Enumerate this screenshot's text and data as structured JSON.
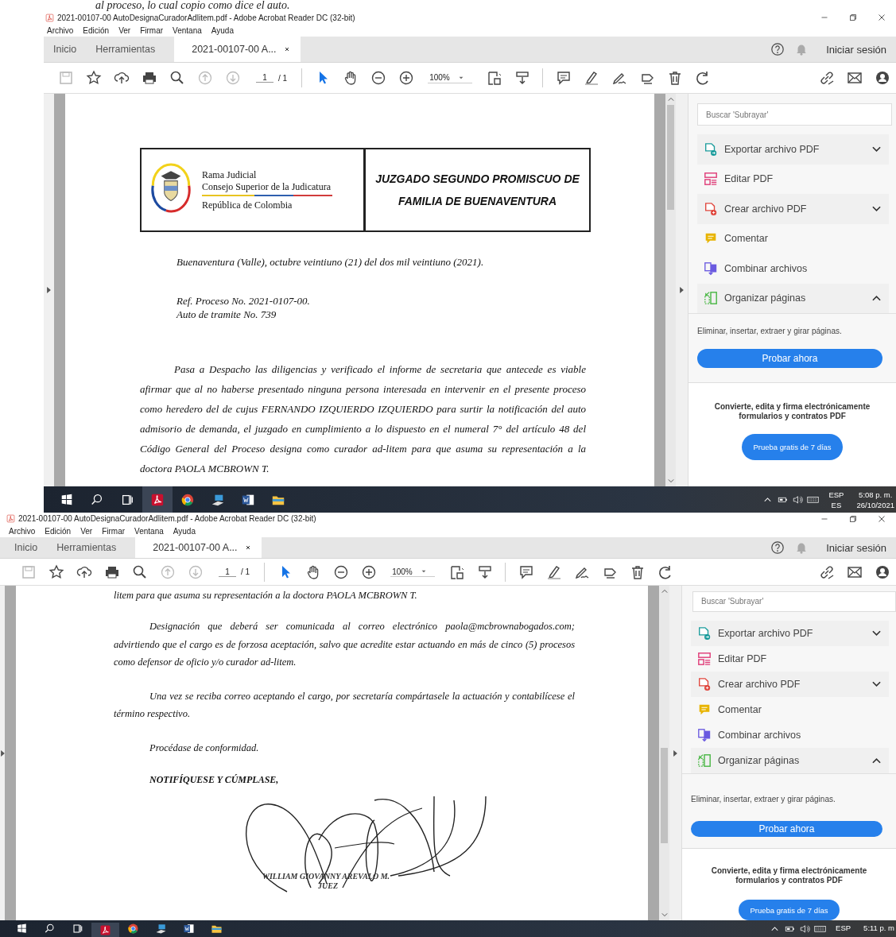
{
  "caption": "al proceso, lo cual copio como dice el auto.",
  "screens": [
    {
      "title": "2021-00107-00 AutoDesignaCuradorAdlitem.pdf - Adobe Acrobat Reader DC (32-bit)",
      "menu": [
        "Archivo",
        "Edición",
        "Ver",
        "Firmar",
        "Ventana",
        "Ayuda"
      ],
      "tabs": [
        {
          "label": "Inicio",
          "selected": false
        },
        {
          "label": "Herramientas",
          "selected": false
        },
        {
          "label": "2021-00107-00 A...",
          "selected": true
        }
      ],
      "sign_in": "Iniciar sesión",
      "page_number": "1",
      "page_total": "/ 1",
      "zoom": "100%",
      "search_placeholder": "Buscar 'Subrayar'",
      "tools": [
        {
          "kind": "export",
          "label": "Exportar archivo PDF",
          "expanded": false
        },
        {
          "kind": "edit",
          "label": "Editar PDF"
        },
        {
          "kind": "create",
          "label": "Crear archivo PDF",
          "expanded": false
        },
        {
          "kind": "comment",
          "label": "Comentar"
        },
        {
          "kind": "combine",
          "label": "Combinar archivos"
        },
        {
          "kind": "organize",
          "label": "Organizar páginas",
          "expanded": true
        }
      ],
      "tool_description": "Eliminar, insertar, extraer y girar páginas.",
      "try_button": "Probar ahora",
      "promo": "Convierte, edita y firma electrónicamente formularios y contratos PDF",
      "trial_button": "Prueba gratis de 7 días",
      "document": [
        {
          "kind": "letterhead",
          "lines": [
            "Rama Judicial",
            "Consejo Superior de la Judicatura",
            "República de Colombia"
          ],
          "title_lines": [
            "JUZGADO SEGUNDO PROMISCUO DE",
            "FAMILIA DE BUENAVENTURA"
          ]
        },
        {
          "kind": "line",
          "text": "Buenaventura (Valle), octubre veintiuno (21) del dos mil veintiuno (2021)."
        },
        {
          "kind": "lines",
          "lines": [
            "Ref. Proceso No. 2021-0107-00.",
            "Auto de tramite No. 739"
          ]
        },
        {
          "kind": "paragraph",
          "text": "Pasa a Despacho las diligencias y verificado el informe de secretaria que antecede es viable afirmar que al no haberse presentado ninguna persona interesada en intervenir en el presente proceso como heredero del de cujus FERNANDO IZQUIERDO IZQUIERDO para surtir la notificación del auto admisorio de demanda, el juzgado en cumplimiento a lo dispuesto en el numeral 7° del artículo 48 del Código General del Proceso designa como curador ad-litem para que asuma su representación a la doctora PAOLA MCBROWN T."
        }
      ],
      "taskbar": {
        "language": "ESP",
        "layout": "ES",
        "time": "5:08 p. m.",
        "date": "26/10/2021"
      }
    },
    {
      "title": "2021-00107-00 AutoDesignaCuradorAdlitem.pdf - Adobe Acrobat Reader DC (32-bit)",
      "menu": [
        "Archivo",
        "Edición",
        "Ver",
        "Firmar",
        "Ventana",
        "Ayuda"
      ],
      "tabs": [
        {
          "label": "Inicio",
          "selected": false
        },
        {
          "label": "Herramientas",
          "selected": false
        },
        {
          "label": "2021-00107-00 A...",
          "selected": true
        }
      ],
      "sign_in": "Iniciar sesión",
      "page_number": "1",
      "page_total": "/ 1",
      "zoom": "100%",
      "search_placeholder": "Buscar 'Subrayar'",
      "tools": [
        {
          "kind": "export",
          "label": "Exportar archivo PDF",
          "expanded": false
        },
        {
          "kind": "edit",
          "label": "Editar PDF"
        },
        {
          "kind": "create",
          "label": "Crear archivo PDF",
          "expanded": false
        },
        {
          "kind": "comment",
          "label": "Comentar"
        },
        {
          "kind": "combine",
          "label": "Combinar archivos"
        },
        {
          "kind": "organize",
          "label": "Organizar páginas",
          "expanded": true
        }
      ],
      "tool_description": "Eliminar, insertar, extraer y girar páginas.",
      "try_button": "Probar ahora",
      "promo": "Convierte, edita y firma electrónicamente formularios y contratos PDF",
      "trial_button": "Prueba gratis de 7 días",
      "document": [
        {
          "kind": "line",
          "text": "litem para que asuma su representación a la doctora PAOLA MCBROWN T."
        },
        {
          "kind": "paragraph",
          "text": "Designación que deberá ser comunicada al correo electrónico paola@mcbrownabogados.com; advirtiendo que el cargo es de forzosa aceptación, salvo que acredite estar actuando en más de cinco (5) procesos como defensor de oficio y/o curador ad-litem."
        },
        {
          "kind": "paragraph",
          "text": "Una vez se reciba correo aceptando el cargo, por secretaría compártasele la actuación y contabilícese el término respectivo."
        },
        {
          "kind": "paragraph",
          "text": "Procédase de conformidad."
        },
        {
          "kind": "closing",
          "text": "NOTIFÍQUESE Y CÚMPLASE,"
        },
        {
          "kind": "signature",
          "name": "WILLIAM GIOVANNY AREVALO M.",
          "role": "JUEZ"
        }
      ],
      "taskbar": {
        "language": "ESP",
        "time": "5:11 p. m"
      }
    }
  ]
}
